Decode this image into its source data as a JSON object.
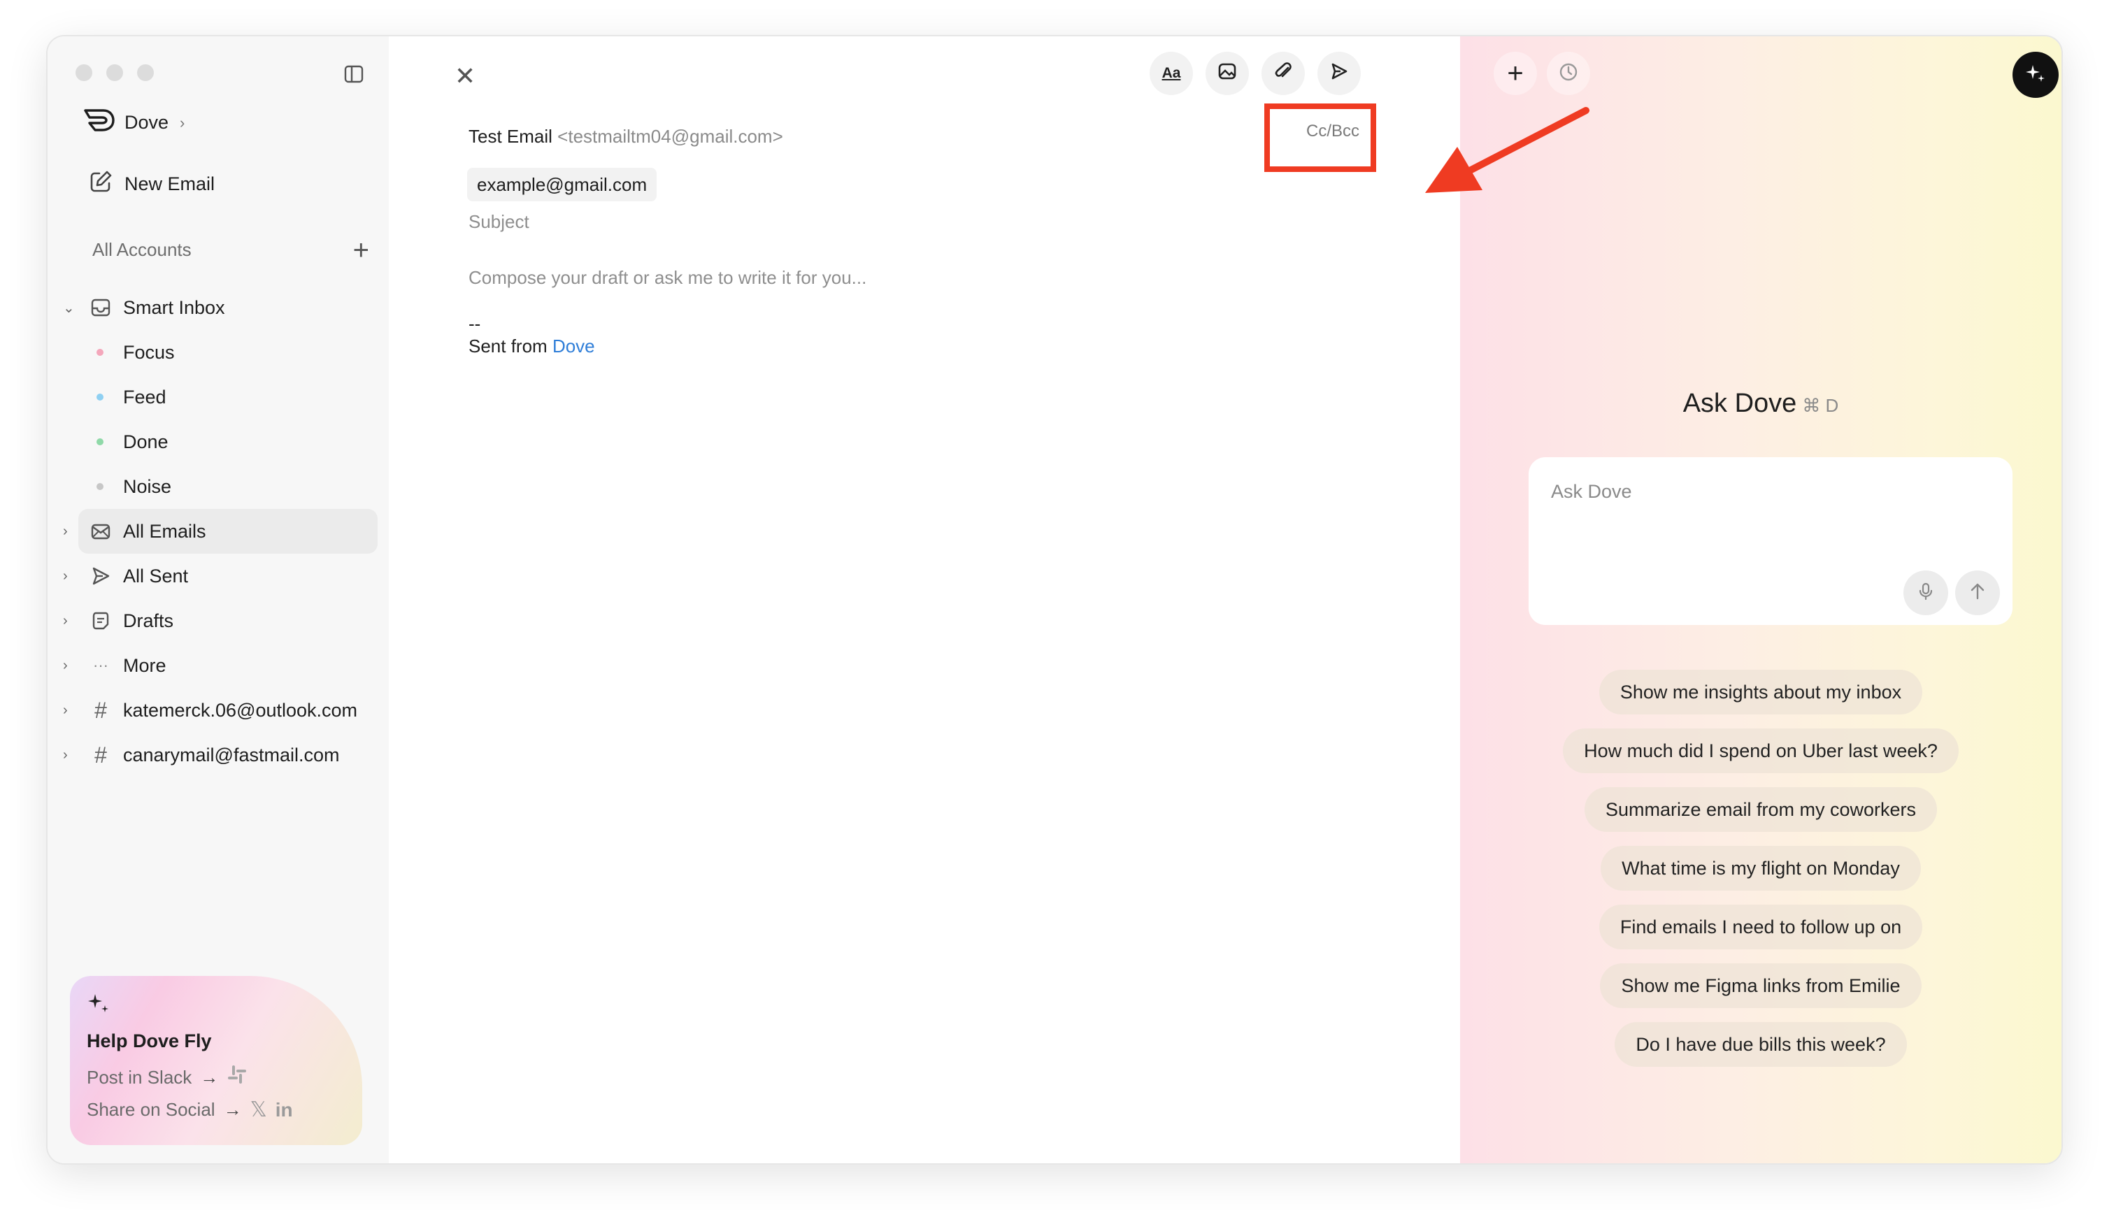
{
  "sidebar": {
    "brand": "Dove",
    "new_email": "New Email",
    "accounts_label": "All Accounts",
    "items": [
      {
        "label": "Smart Inbox"
      },
      {
        "label": "Focus",
        "dot": "#f4a7bb"
      },
      {
        "label": "Feed",
        "dot": "#8fd0f2"
      },
      {
        "label": "Done",
        "dot": "#8fd9a8"
      },
      {
        "label": "Noise",
        "dot": "#c7c7c7"
      },
      {
        "label": "All Emails"
      },
      {
        "label": "All Sent"
      },
      {
        "label": "Drafts"
      },
      {
        "label": "More"
      },
      {
        "label": "katemerck.06@outlook.com"
      },
      {
        "label": "canarymail@fastmail.com"
      }
    ],
    "promo": {
      "title": "Help Dove Fly",
      "post_slack": "Post in Slack",
      "share_social": "Share on Social"
    }
  },
  "compose": {
    "from_name": "Test Email",
    "from_addr": "<testmailtm04@gmail.com>",
    "cc_bcc": "Cc/Bcc",
    "to": "example@gmail.com",
    "subject_placeholder": "Subject",
    "body_placeholder": "Compose your draft or ask me to write it for you...",
    "sig_dash": "--",
    "sig_prefix": "Sent from ",
    "sig_link": "Dove",
    "toolbar": {
      "format": "Aa"
    }
  },
  "ask": {
    "title": "Ask Dove",
    "shortcut": "⌘ D",
    "input_placeholder": "Ask Dove",
    "suggestions": [
      "Show me insights about my inbox",
      "How much did I spend on Uber last week?",
      "Summarize email from my coworkers",
      "What time is my flight on Monday",
      "Find emails I need to follow up on",
      "Show me Figma links from Emilie",
      "Do I have due bills this week?"
    ]
  },
  "colors": {
    "annotation": "#ef3b22",
    "link": "#2f7ed8"
  }
}
